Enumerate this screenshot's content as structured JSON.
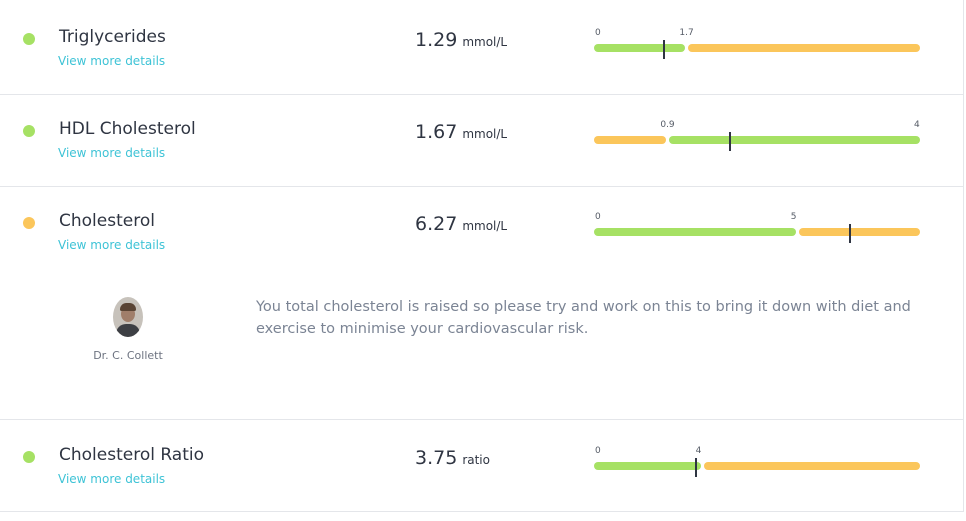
{
  "colors": {
    "green": "#a6e164",
    "amber": "#fbc65b",
    "link": "#3ec3d6"
  },
  "results": [
    {
      "name": "Triglycerides",
      "status": "normal",
      "details_label": "View more details",
      "value": "1.29",
      "unit": "mmol/L",
      "range": {
        "min": 0,
        "max": 6,
        "value": 1.29,
        "segments": [
          {
            "from": 0,
            "to": 1.7,
            "color": "green"
          },
          {
            "from": 1.7,
            "to": 6,
            "color": "amber"
          }
        ],
        "ticks": [
          "0",
          "1.7"
        ]
      }
    },
    {
      "name": "HDL Cholesterol",
      "status": "normal",
      "details_label": "View more details",
      "value": "1.67",
      "unit": "mmol/L",
      "range": {
        "min": 0,
        "max": 4,
        "value": 1.67,
        "segments": [
          {
            "from": 0,
            "to": 0.9,
            "color": "amber"
          },
          {
            "from": 0.9,
            "to": 4,
            "color": "green"
          }
        ],
        "ticks": [
          "0.9",
          "4"
        ]
      }
    },
    {
      "name": "Cholesterol",
      "status": "raised",
      "details_label": "View more details",
      "value": "6.27",
      "unit": "mmol/L",
      "range": {
        "min": 0,
        "max": 8,
        "value": 6.27,
        "segments": [
          {
            "from": 0,
            "to": 5,
            "color": "green"
          },
          {
            "from": 5,
            "to": 8,
            "color": "amber"
          }
        ],
        "ticks": [
          "0",
          "5"
        ]
      },
      "doctor_note": {
        "doctor": "Dr. C. Collett",
        "text": "You total cholesterol is raised so please try and work on this to bring it down with diet and exercise to minimise your cardiovascular risk."
      }
    },
    {
      "name": "Cholesterol Ratio",
      "status": "normal",
      "details_label": "View more details",
      "value": "3.75",
      "unit": "ratio",
      "range": {
        "min": 0,
        "max": 12,
        "value": 3.75,
        "segments": [
          {
            "from": 0,
            "to": 4,
            "color": "green"
          },
          {
            "from": 4,
            "to": 12,
            "color": "amber"
          }
        ],
        "ticks": [
          "0",
          "4"
        ]
      }
    }
  ]
}
